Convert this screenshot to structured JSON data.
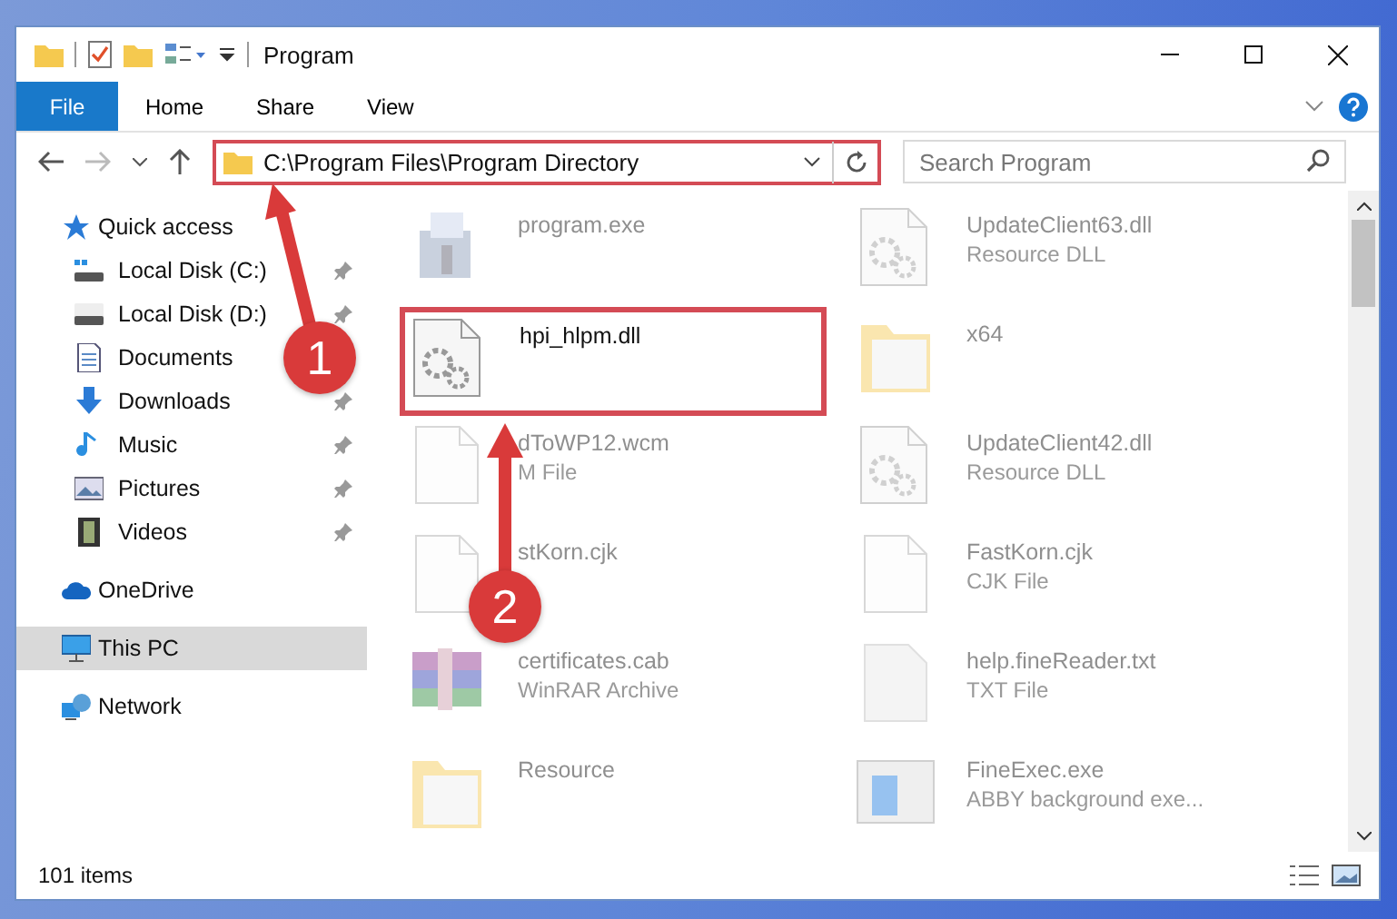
{
  "window": {
    "title": "Program"
  },
  "ribbon": {
    "tabs": [
      {
        "label": "File",
        "kind": "file"
      },
      {
        "label": "Home",
        "kind": "tab"
      },
      {
        "label": "Share",
        "kind": "tab"
      },
      {
        "label": "View",
        "kind": "tab"
      }
    ]
  },
  "address_bar": {
    "path": "C:\\Program Files\\Program Directory",
    "highlighted": true
  },
  "search": {
    "placeholder": "Search Program"
  },
  "sidebar": {
    "items": [
      {
        "label": "Quick access",
        "kind": "star",
        "selected": false,
        "children": [
          {
            "label": "Local Disk (C:)",
            "kind": "disk-c",
            "pinned": true
          },
          {
            "label": "Local Disk (D:)",
            "kind": "disk",
            "pinned": true
          },
          {
            "label": "Documents",
            "kind": "documents"
          },
          {
            "label": "Downloads",
            "kind": "downloads",
            "pinned": true
          },
          {
            "label": "Music",
            "kind": "music",
            "pinned": true
          },
          {
            "label": "Pictures",
            "kind": "pictures",
            "pinned": true
          },
          {
            "label": "Videos",
            "kind": "videos",
            "pinned": true
          }
        ]
      },
      {
        "label": "OneDrive",
        "kind": "cloud",
        "selected": false
      },
      {
        "label": "This PC",
        "kind": "pc",
        "selected": true
      },
      {
        "label": "Network",
        "kind": "network",
        "selected": false
      }
    ]
  },
  "files": [
    {
      "name": "program.exe",
      "kind": "exe",
      "faded": true,
      "highlighted": false
    },
    {
      "name": "UpdateClient63.dll",
      "type": "Resource DLL",
      "kind": "dll",
      "faded": true,
      "highlighted": false
    },
    {
      "name": "hpi_hlpm.dll",
      "kind": "gear",
      "faded": false,
      "highlighted": true
    },
    {
      "name": "x64",
      "kind": "folder",
      "faded": true,
      "highlighted": false
    },
    {
      "name": "dToWP12.wcm",
      "type": "M File",
      "kind": "blank",
      "faded": true,
      "highlighted": false
    },
    {
      "name": "UpdateClient42.dll",
      "type": "Resource DLL",
      "kind": "dll",
      "faded": true,
      "highlighted": false
    },
    {
      "name": "stKorn.cjk",
      "kind": "blank",
      "faded": true,
      "highlighted": false
    },
    {
      "name": "FastKorn.cjk",
      "type": "CJK File",
      "kind": "blank",
      "faded": true,
      "highlighted": false
    },
    {
      "name": "certificates.cab",
      "type": "WinRAR Archive",
      "kind": "archive",
      "faded": true,
      "highlighted": false
    },
    {
      "name": "help.fineReader.txt",
      "type": "TXT File",
      "kind": "text",
      "faded": true,
      "highlighted": false
    },
    {
      "name": "Resource",
      "kind": "folder",
      "faded": true,
      "highlighted": false
    },
    {
      "name": "FineExec.exe",
      "type": "ABBY background exe...",
      "kind": "app",
      "faded": true,
      "highlighted": false
    }
  ],
  "status_bar": {
    "count": "101 items"
  },
  "annotations": [
    {
      "number": "1"
    },
    {
      "number": "2"
    }
  ]
}
